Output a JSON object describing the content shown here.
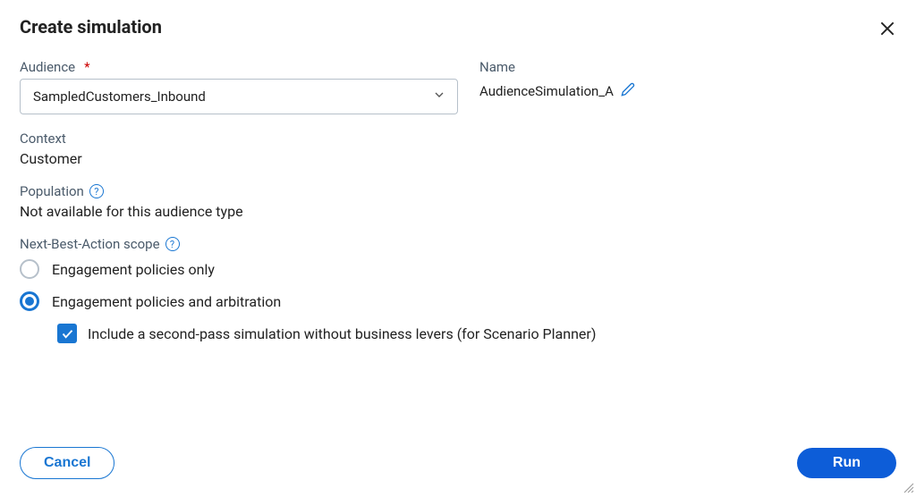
{
  "dialog": {
    "title": "Create simulation"
  },
  "fields": {
    "audience": {
      "label": "Audience",
      "required": "*",
      "value": "SampledCustomers_Inbound"
    },
    "name": {
      "label": "Name",
      "value": "AudienceSimulation_A"
    },
    "context": {
      "label": "Context",
      "value": "Customer"
    },
    "population": {
      "label": "Population",
      "value": "Not available for this audience type"
    },
    "scope": {
      "label": "Next-Best-Action scope",
      "options": {
        "policies_only": "Engagement policies only",
        "policies_arbitration": "Engagement policies and arbitration"
      },
      "second_pass": "Include a second-pass simulation without business levers (for Scenario Planner)"
    }
  },
  "buttons": {
    "cancel": "Cancel",
    "run": "Run"
  },
  "help_symbol": "?"
}
